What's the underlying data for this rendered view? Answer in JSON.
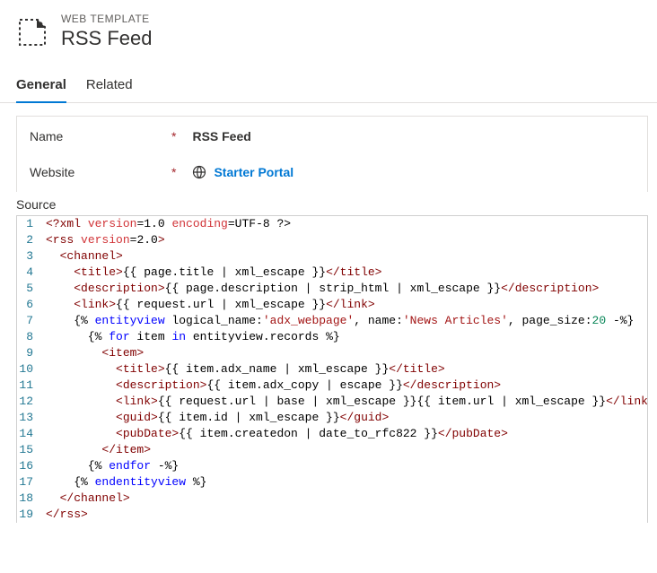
{
  "header": {
    "kicker": "WEB TEMPLATE",
    "title": "RSS Feed"
  },
  "tabs": {
    "general": "General",
    "related": "Related"
  },
  "form": {
    "name_label": "Name",
    "name_value": "RSS Feed",
    "website_label": "Website",
    "website_value": "Starter Portal",
    "required_marker": "*",
    "source_label": "Source"
  },
  "code": {
    "lines": [
      {
        "n": "1",
        "indent": 0,
        "tokens": [
          [
            "decl",
            "<?xml"
          ],
          [
            "text",
            " "
          ],
          [
            "attr",
            "version"
          ],
          [
            "text",
            "=1.0 "
          ],
          [
            "attr",
            "encoding"
          ],
          [
            "text",
            "=UTF-8 ?>"
          ]
        ]
      },
      {
        "n": "2",
        "indent": 0,
        "tokens": [
          [
            "tag",
            "<rss"
          ],
          [
            "text",
            " "
          ],
          [
            "attr",
            "version"
          ],
          [
            "text",
            "=2.0"
          ],
          [
            "tag",
            ">"
          ]
        ]
      },
      {
        "n": "3",
        "indent": 1,
        "tokens": [
          [
            "tag",
            "<channel>"
          ]
        ]
      },
      {
        "n": "4",
        "indent": 2,
        "tokens": [
          [
            "tag",
            "<title>"
          ],
          [
            "text",
            "{{ page.title | xml_escape }}"
          ],
          [
            "tag",
            "</title>"
          ]
        ]
      },
      {
        "n": "5",
        "indent": 2,
        "tokens": [
          [
            "tag",
            "<description>"
          ],
          [
            "text",
            "{{ page.description | strip_html | xml_escape }}"
          ],
          [
            "tag",
            "</description>"
          ]
        ]
      },
      {
        "n": "6",
        "indent": 2,
        "tokens": [
          [
            "tag",
            "<link>"
          ],
          [
            "text",
            "{{ request.url | xml_escape }}"
          ],
          [
            "tag",
            "</link>"
          ]
        ]
      },
      {
        "n": "7",
        "indent": 2,
        "tokens": [
          [
            "text",
            "{% "
          ],
          [
            "kw",
            "entityview"
          ],
          [
            "text",
            " logical_name:"
          ],
          [
            "str",
            "'adx_webpage'"
          ],
          [
            "text",
            ", name:"
          ],
          [
            "str",
            "'News Articles'"
          ],
          [
            "text",
            ", page_size:"
          ],
          [
            "num",
            "20"
          ],
          [
            "text",
            " -%}"
          ]
        ]
      },
      {
        "n": "8",
        "indent": 3,
        "tokens": [
          [
            "text",
            "{% "
          ],
          [
            "kw",
            "for"
          ],
          [
            "text",
            " item "
          ],
          [
            "kw",
            "in"
          ],
          [
            "text",
            " entityview.records %}"
          ]
        ]
      },
      {
        "n": "9",
        "indent": 4,
        "tokens": [
          [
            "tag",
            "<item>"
          ]
        ]
      },
      {
        "n": "10",
        "indent": 5,
        "tokens": [
          [
            "tag",
            "<title>"
          ],
          [
            "text",
            "{{ item.adx_name | xml_escape }}"
          ],
          [
            "tag",
            "</title>"
          ]
        ]
      },
      {
        "n": "11",
        "indent": 5,
        "tokens": [
          [
            "tag",
            "<description>"
          ],
          [
            "text",
            "{{ item.adx_copy | escape }}"
          ],
          [
            "tag",
            "</description>"
          ]
        ]
      },
      {
        "n": "12",
        "indent": 5,
        "tokens": [
          [
            "tag",
            "<link>"
          ],
          [
            "text",
            "{{ request.url | base | xml_escape }}{{ item.url | xml_escape }}"
          ],
          [
            "tag",
            "</link>"
          ]
        ]
      },
      {
        "n": "13",
        "indent": 5,
        "tokens": [
          [
            "tag",
            "<guid>"
          ],
          [
            "text",
            "{{ item.id | xml_escape }}"
          ],
          [
            "tag",
            "</guid>"
          ]
        ]
      },
      {
        "n": "14",
        "indent": 5,
        "tokens": [
          [
            "tag",
            "<pubDate>"
          ],
          [
            "text",
            "{{ item.createdon | date_to_rfc822 }}"
          ],
          [
            "tag",
            "</pubDate>"
          ]
        ]
      },
      {
        "n": "15",
        "indent": 4,
        "tokens": [
          [
            "tag",
            "</item>"
          ]
        ]
      },
      {
        "n": "16",
        "indent": 3,
        "tokens": [
          [
            "text",
            "{% "
          ],
          [
            "kw",
            "endfor"
          ],
          [
            "text",
            " -%}"
          ]
        ]
      },
      {
        "n": "17",
        "indent": 2,
        "tokens": [
          [
            "text",
            "{% "
          ],
          [
            "kw",
            "endentityview"
          ],
          [
            "text",
            " %}"
          ]
        ]
      },
      {
        "n": "18",
        "indent": 1,
        "tokens": [
          [
            "tag",
            "</channel>"
          ]
        ]
      },
      {
        "n": "19",
        "indent": 0,
        "tokens": [
          [
            "tag",
            "</rss>"
          ]
        ]
      }
    ]
  }
}
